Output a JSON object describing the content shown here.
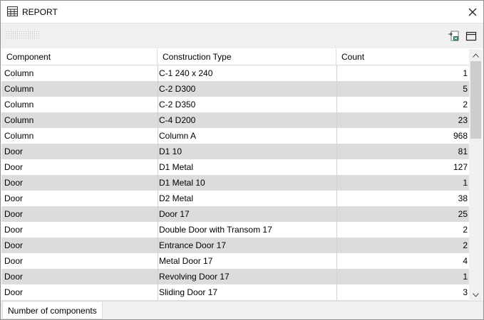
{
  "window": {
    "title": "REPORT"
  },
  "table": {
    "columns": [
      "Component",
      "Construction Type",
      "Count"
    ],
    "rows": [
      [
        "Column",
        "C-1 240 x 240",
        "1"
      ],
      [
        "Column",
        "C-2 D300",
        "5"
      ],
      [
        "Column",
        "C-2 D350",
        "2"
      ],
      [
        "Column",
        "C-4 D200",
        "23"
      ],
      [
        "Column",
        "Column A",
        "968"
      ],
      [
        "Door",
        "D1 10",
        "81"
      ],
      [
        "Door",
        "D1 Metal",
        "127"
      ],
      [
        "Door",
        "D1 Metal 10",
        "1"
      ],
      [
        "Door",
        "D2 Metal",
        "38"
      ],
      [
        "Door",
        "Door 17",
        "25"
      ],
      [
        "Door",
        "Double Door with Transom 17",
        "2"
      ],
      [
        "Door",
        "Entrance Door 17",
        "2"
      ],
      [
        "Door",
        "Metal Door 17",
        "4"
      ],
      [
        "Door",
        "Revolving Door 17",
        "1"
      ],
      [
        "Door",
        "Sliding Door 17",
        "3"
      ],
      [
        "",
        "",
        ""
      ]
    ]
  },
  "statusbar": {
    "tab_label": "Number of components"
  },
  "icons": {
    "app": "table-icon",
    "close": "close-icon",
    "export": "export-excel-icon",
    "layout": "window-layout-icon"
  }
}
